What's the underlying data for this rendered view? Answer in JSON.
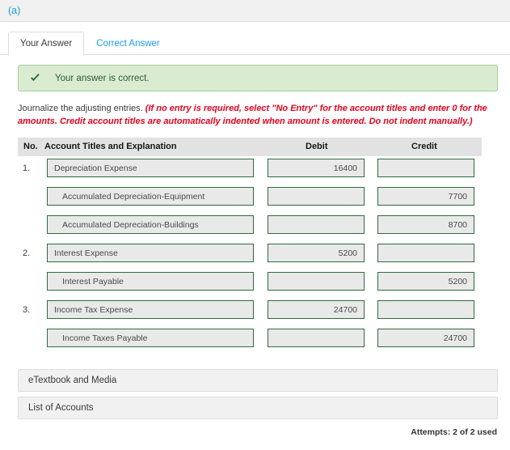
{
  "header": {
    "part_label": "(a)"
  },
  "tabs": [
    {
      "label": "Your Answer",
      "active": true
    },
    {
      "label": "Correct Answer",
      "active": false
    }
  ],
  "banner": {
    "icon": "check-icon",
    "text": "Your answer is correct.",
    "background": "#d9ecd1",
    "border": "#a3cf9a",
    "text_color": "#2c5d32"
  },
  "instructions": {
    "normal": "Journalize the adjusting entries.",
    "emphasis": "(If no entry is required, select \"No Entry\" for the account titles and enter 0 for the amounts. Credit account titles are automatically indented when amount is entered. Do not indent manually.)",
    "emphasis_color": "#e8001c"
  },
  "table": {
    "headers": {
      "no": "No.",
      "account": "Account Titles and Explanation",
      "debit": "Debit",
      "credit": "Credit"
    },
    "header_background": "#e2e2e2",
    "field_border": "#2e6b3e",
    "field_background": "#e9e9e9",
    "rows": [
      {
        "no": "1.",
        "account": "Depreciation Expense",
        "indent": false,
        "debit": "16400",
        "credit": ""
      },
      {
        "no": "",
        "account": "Accumulated Depreciation-Equipment",
        "indent": true,
        "debit": "",
        "credit": "7700"
      },
      {
        "no": "",
        "account": "Accumulated Depreciation-Buildings",
        "indent": true,
        "debit": "",
        "credit": "8700"
      },
      {
        "no": "2.",
        "account": "Interest Expense",
        "indent": false,
        "debit": "5200",
        "credit": ""
      },
      {
        "no": "",
        "account": "Interest Payable",
        "indent": true,
        "debit": "",
        "credit": "5200"
      },
      {
        "no": "3.",
        "account": "Income Tax Expense",
        "indent": false,
        "debit": "24700",
        "credit": ""
      },
      {
        "no": "",
        "account": "Income Taxes Payable",
        "indent": true,
        "debit": "",
        "credit": "24700"
      }
    ]
  },
  "panels": [
    {
      "label": "eTextbook and Media"
    },
    {
      "label": "List of Accounts"
    }
  ],
  "footer": {
    "attempts": "Attempts: 2 of 2 used"
  }
}
